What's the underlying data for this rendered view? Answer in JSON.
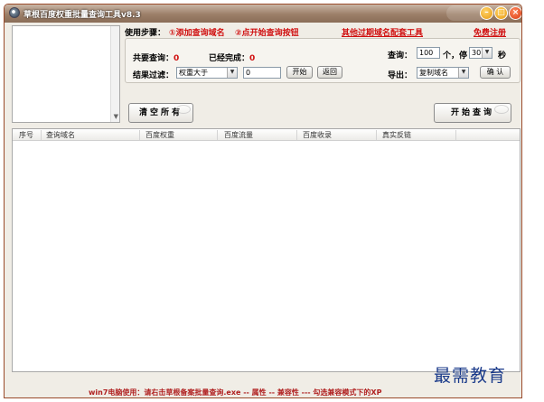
{
  "window": {
    "title": "草根百度权重批量查询工具v8.3"
  },
  "steps": {
    "label": "使用步骤：",
    "step1": "①添加查询域名",
    "step2": "②点开始查询按钮",
    "link_tools": "其他过期域名配套工具",
    "link_register": "免费注册"
  },
  "stats": {
    "total_label": "共要查询：",
    "total_value": "0",
    "done_label": "已经完成：",
    "done_value": "0"
  },
  "query": {
    "label": "查询：",
    "count_value": "100",
    "count_unit": "个，停",
    "pause_value": "30",
    "pause_unit": "秒"
  },
  "filter": {
    "label": "结果过滤：",
    "selected": "权重大于",
    "value": "0",
    "start_label": "开始",
    "back_label": "返回"
  },
  "export": {
    "label": "导出：",
    "selected": "复制域名",
    "confirm_label": "确 认"
  },
  "buttons": {
    "clear_all": "清空所有",
    "start_query": "开始查询"
  },
  "table": {
    "columns": [
      "序号",
      "查询域名",
      "百度权重",
      "百度流量",
      "百度收录",
      "真实反链"
    ]
  },
  "footer": {
    "tip": "win7电脑使用：请右击草根备案批量查询.exe -- 属性 -- 兼容性 --- 勾选兼容模式下的XP"
  },
  "watermark": {
    "text": "最需教育"
  }
}
